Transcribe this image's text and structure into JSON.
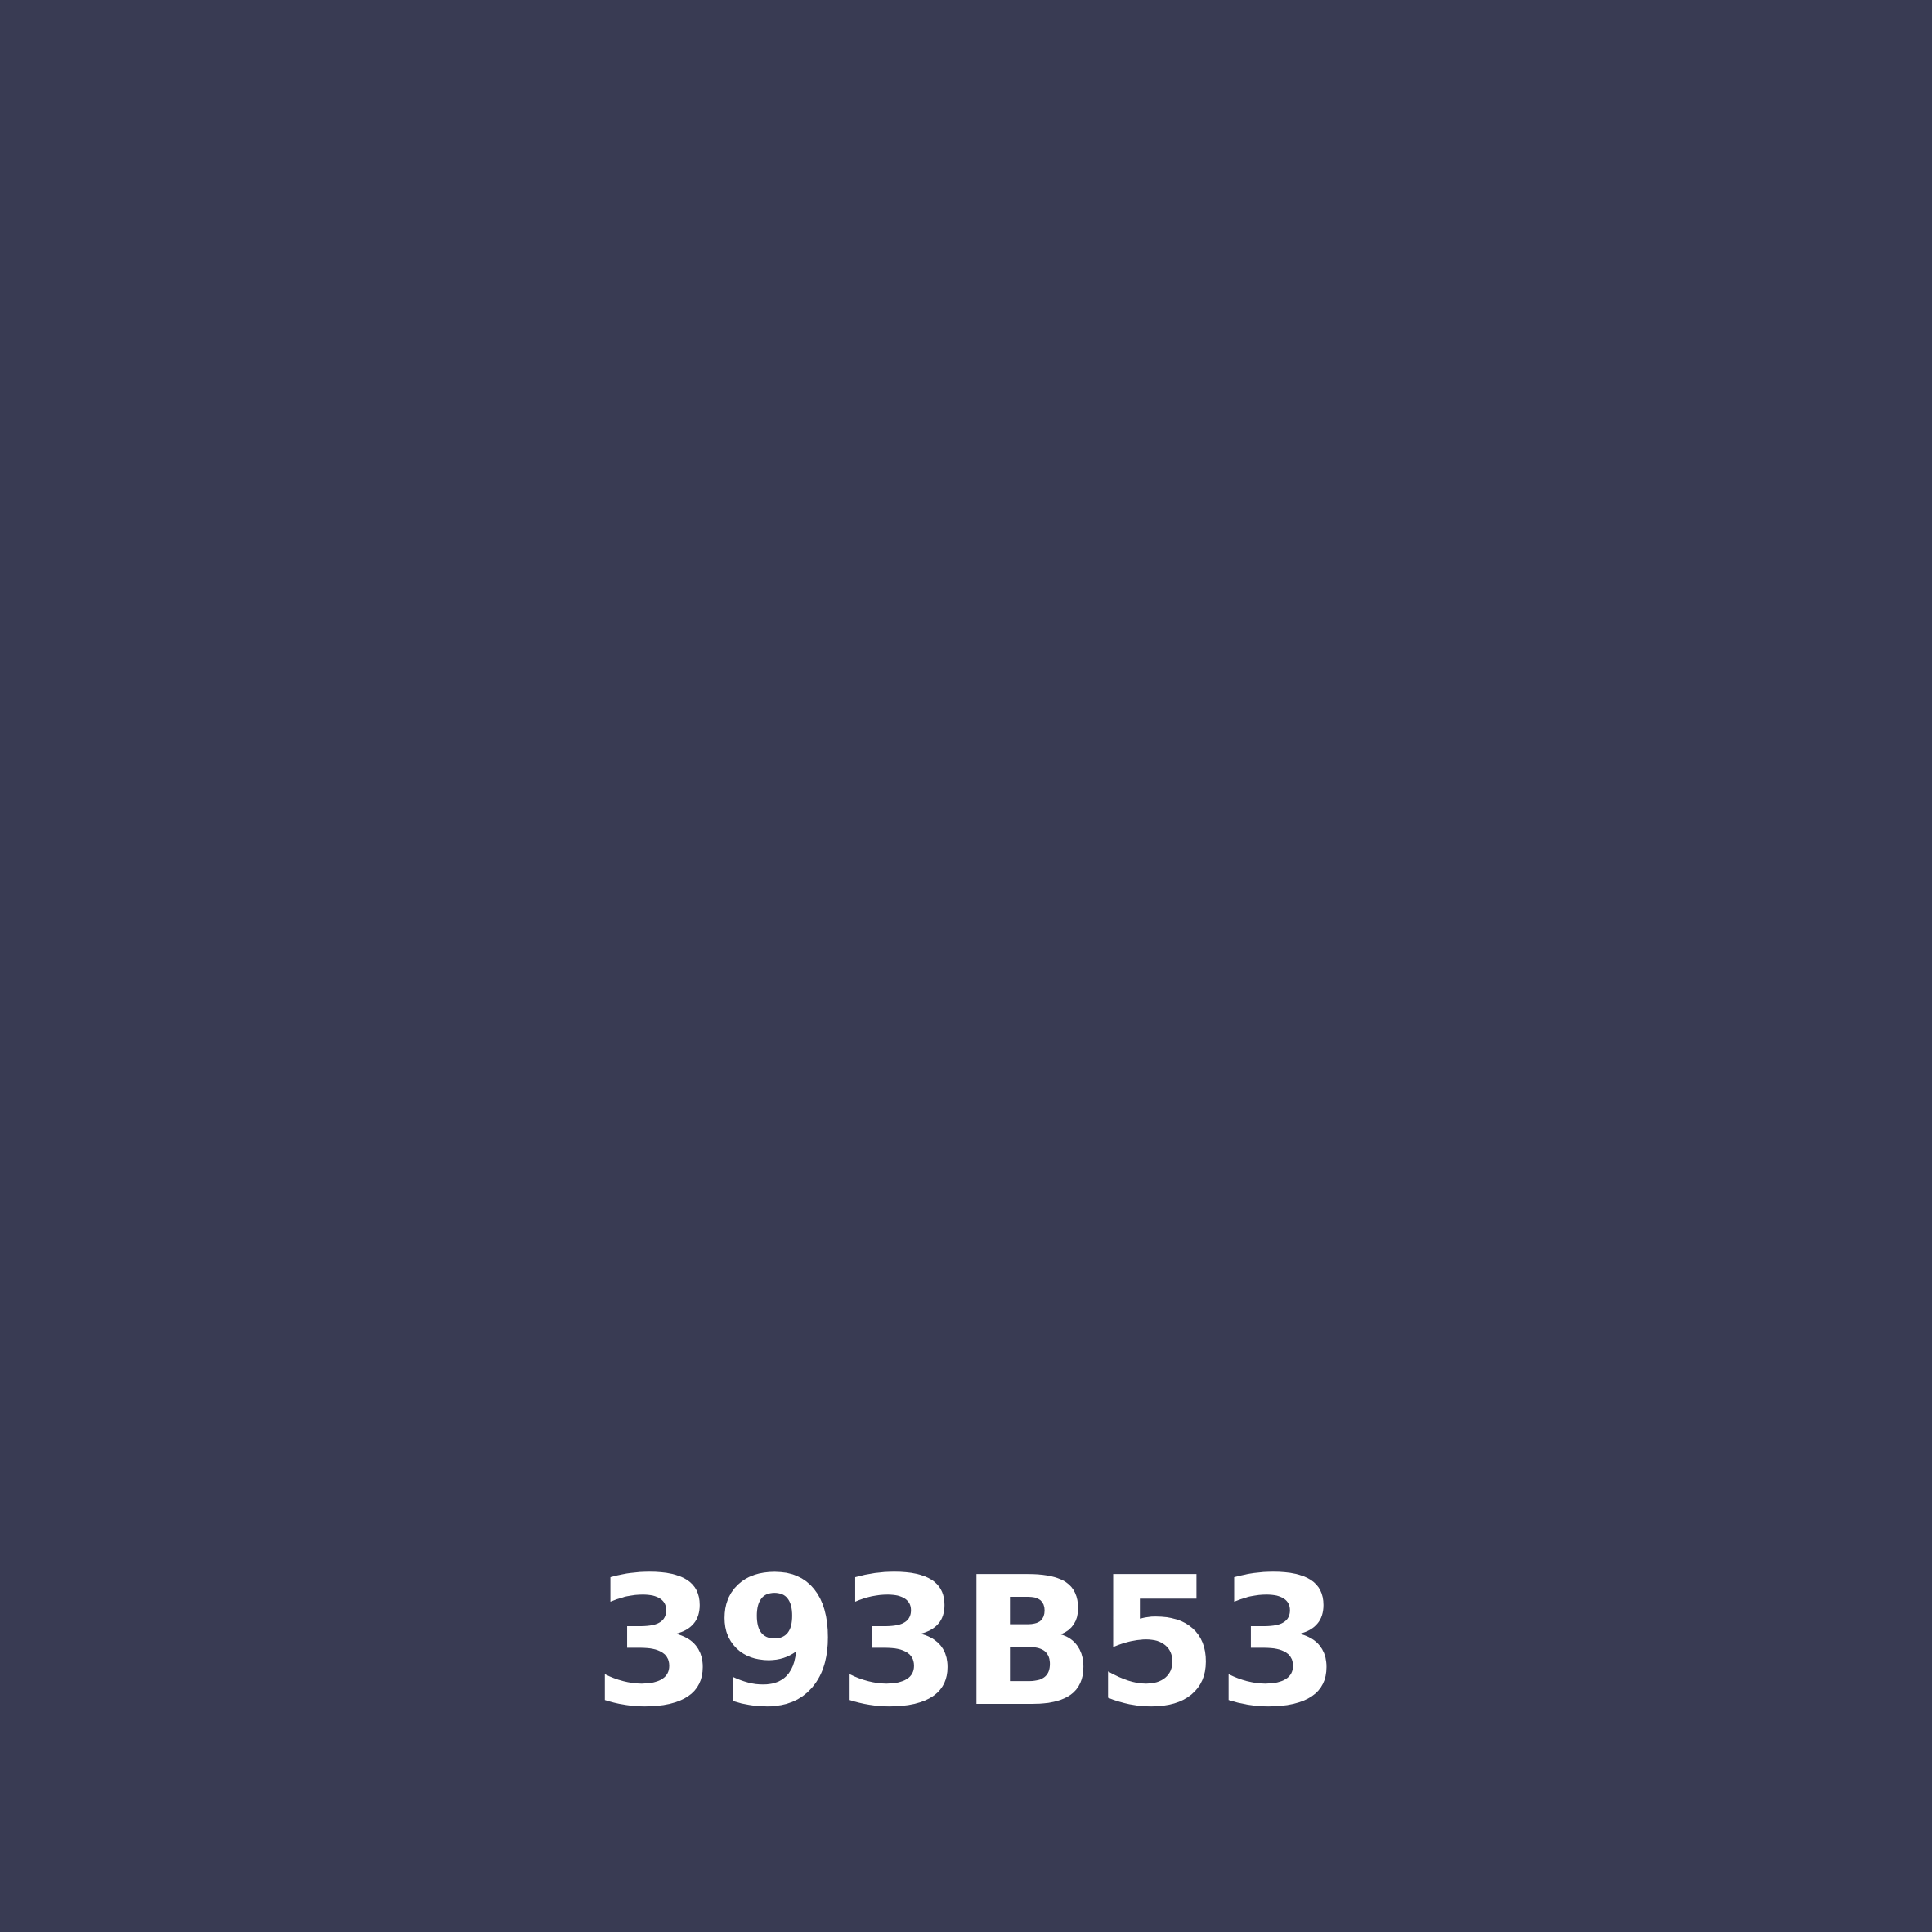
{
  "swatch": {
    "color": "#393B53",
    "label": "393B53",
    "label_color": "#FFFFFF"
  }
}
